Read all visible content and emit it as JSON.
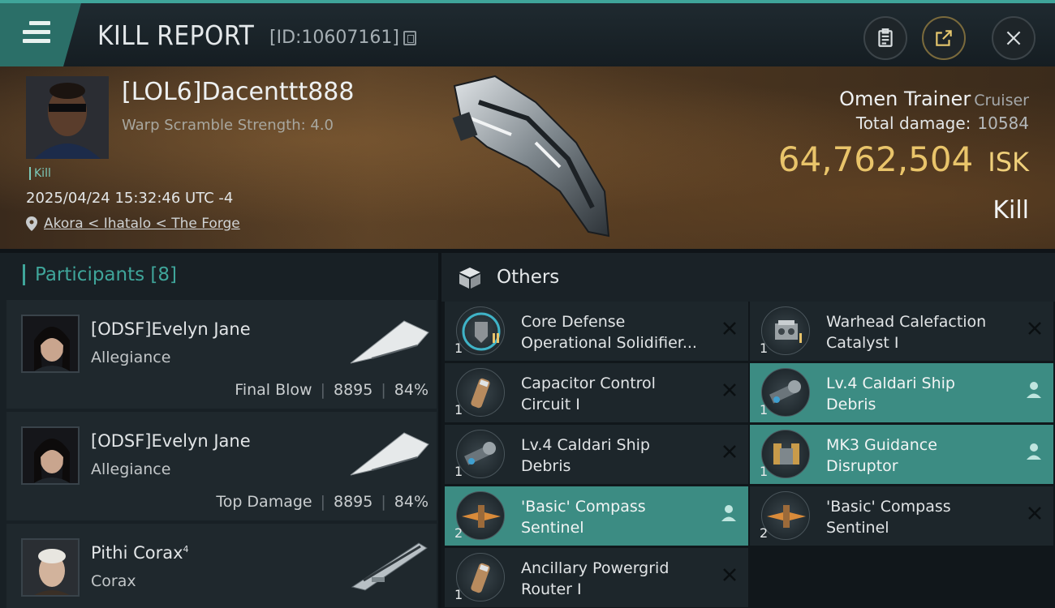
{
  "header": {
    "title": "KILL REPORT",
    "id_label": "[ID:10607161]"
  },
  "banner": {
    "player_name": "[LOL6]Dacenttt888",
    "warp_scramble": "Warp Scramble Strength: 4.0",
    "kill_tag": "Kill",
    "datetime": "2025/04/24 15:32:46 UTC -4",
    "location": "Akora < Ihatalo < The Forge",
    "ship_name": "Omen Trainer",
    "ship_class": "Cruiser",
    "total_damage_label": "Total damage:",
    "total_damage_value": "10584",
    "isk_value": "64,762,504",
    "isk_unit": "ISK",
    "result": "Kill"
  },
  "participants": {
    "title": "Participants [8]",
    "items": [
      {
        "name": "[ODSF]Evelyn Jane",
        "ship": "Allegiance",
        "role": "Final Blow",
        "damage": "8895",
        "percent": "84%"
      },
      {
        "name": "[ODSF]Evelyn Jane",
        "ship": "Allegiance",
        "role": "Top Damage",
        "damage": "8895",
        "percent": "84%"
      },
      {
        "name": "Pithi Corax",
        "name_sup": "4",
        "ship": "Corax"
      }
    ]
  },
  "others": {
    "title": "Others",
    "items": [
      {
        "qty": "1",
        "name": "Core Defense Operational Solidifier...",
        "status": "destroyed"
      },
      {
        "qty": "1",
        "name": "Warhead Calefaction Catalyst I",
        "status": "destroyed"
      },
      {
        "qty": "1",
        "name": "Capacitor Control Circuit I",
        "status": "destroyed"
      },
      {
        "qty": "1",
        "name": "Lv.4 Caldari Ship Debris",
        "status": "dropped"
      },
      {
        "qty": "1",
        "name": "Lv.4 Caldari Ship Debris",
        "status": "destroyed"
      },
      {
        "qty": "1",
        "name": "MK3 Guidance Disruptor",
        "status": "dropped"
      },
      {
        "qty": "2",
        "name": "'Basic' Compass Sentinel",
        "status": "dropped"
      },
      {
        "qty": "2",
        "name": "'Basic' Compass Sentinel",
        "status": "destroyed"
      },
      {
        "qty": "1",
        "name": "Ancillary Powergrid Router I",
        "status": "destroyed"
      }
    ]
  },
  "colors": {
    "accent": "#3fa59a",
    "isk": "#e9c46a",
    "highlight": "#3c8c83"
  }
}
